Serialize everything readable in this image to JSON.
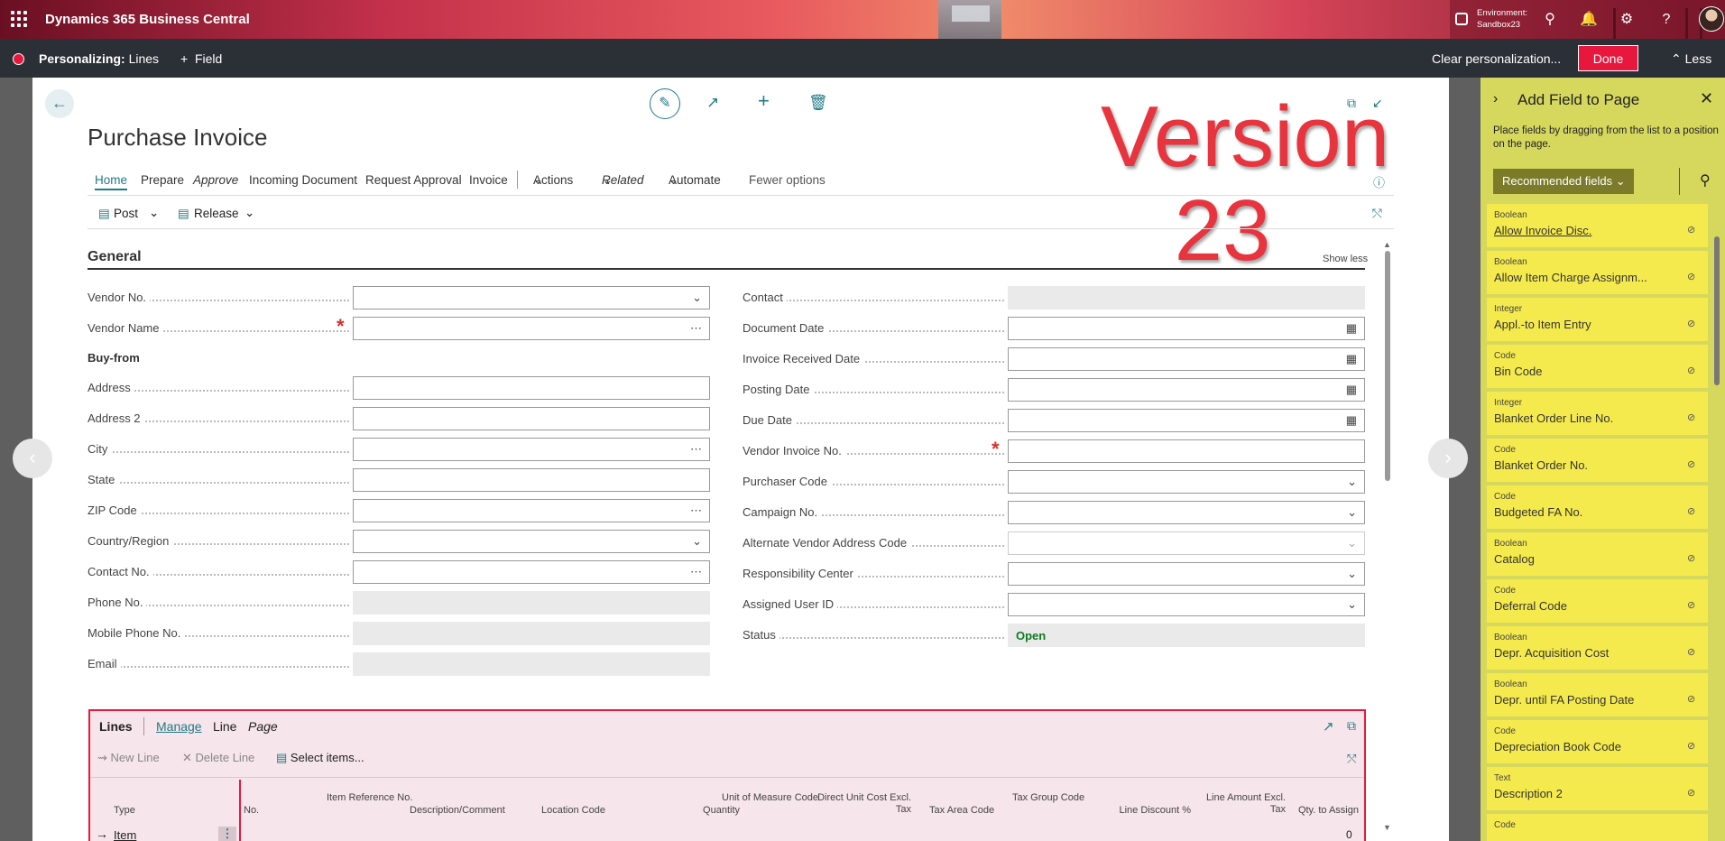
{
  "app": {
    "name": "Dynamics 365 Business Central",
    "environment_label": "Environment:",
    "environment_value": "Sandbox23"
  },
  "personalize": {
    "title_bold": "Personalizing:",
    "title_rest": " Lines",
    "field_label": "Field",
    "clear_label": "Clear personalization...",
    "done_label": "Done",
    "less_label": "Less"
  },
  "page": {
    "title": "Purchase Invoice",
    "overlay_line1": "Version",
    "overlay_line2": "23"
  },
  "tabs": [
    "Home",
    "Prepare",
    "Approve",
    "Incoming Document",
    "Request Approval",
    "Invoice",
    "Actions",
    "Related",
    "Automate",
    "Fewer options"
  ],
  "toolbar": {
    "post": "Post",
    "release": "Release"
  },
  "general": {
    "title": "General",
    "show_less": "Show less",
    "buy_from": "Buy-from"
  },
  "left_fields": [
    "Vendor No.",
    "Vendor Name",
    "Address",
    "Address 2",
    "City",
    "State",
    "ZIP Code",
    "Country/Region",
    "Contact No.",
    "Phone No.",
    "Mobile Phone No.",
    "Email"
  ],
  "right_fields": [
    "Contact",
    "Document Date",
    "Invoice Received Date",
    "Posting Date",
    "Due Date",
    "Vendor Invoice No.",
    "Purchaser Code",
    "Campaign No.",
    "Alternate Vendor Address Code",
    "Responsibility Center",
    "Assigned User ID",
    "Status"
  ],
  "status_value": "Open",
  "lines": {
    "title": "Lines",
    "tabs": [
      "Manage",
      "Line",
      "Page"
    ],
    "tools": {
      "new_line": "New Line",
      "delete_line": "Delete Line",
      "select_items": "Select items..."
    },
    "columns": [
      "Type",
      "No.",
      "Item Reference No.",
      "Description/Comment",
      "Location Code",
      "Quantity",
      "Unit of Measure Code",
      "Direct Unit Cost Excl. Tax",
      "Tax Area Code",
      "Tax Group Code",
      "Line Discount %",
      "Line Amount Excl. Tax",
      "Qty. to Assign"
    ],
    "row": {
      "type": "Item",
      "qty_to_assign": "0"
    }
  },
  "side_panel": {
    "title": "Add Field to Page",
    "description": "Place fields by dragging from the list to a position on the page.",
    "filter_label": "Recommended fields",
    "items": [
      {
        "type": "Boolean",
        "name": "Allow Invoice Disc."
      },
      {
        "type": "Boolean",
        "name": "Allow Item Charge Assignm..."
      },
      {
        "type": "Integer",
        "name": "Appl.-to Item Entry"
      },
      {
        "type": "Code",
        "name": "Bin Code"
      },
      {
        "type": "Integer",
        "name": "Blanket Order Line No."
      },
      {
        "type": "Code",
        "name": "Blanket Order No."
      },
      {
        "type": "Code",
        "name": "Budgeted FA No."
      },
      {
        "type": "Boolean",
        "name": "Catalog"
      },
      {
        "type": "Code",
        "name": "Deferral Code"
      },
      {
        "type": "Boolean",
        "name": "Depr. Acquisition Cost"
      },
      {
        "type": "Boolean",
        "name": "Depr. until FA Posting Date"
      },
      {
        "type": "Code",
        "name": "Depreciation Book Code"
      },
      {
        "type": "Text",
        "name": "Description 2"
      },
      {
        "type": "Code",
        "name": ""
      }
    ]
  }
}
